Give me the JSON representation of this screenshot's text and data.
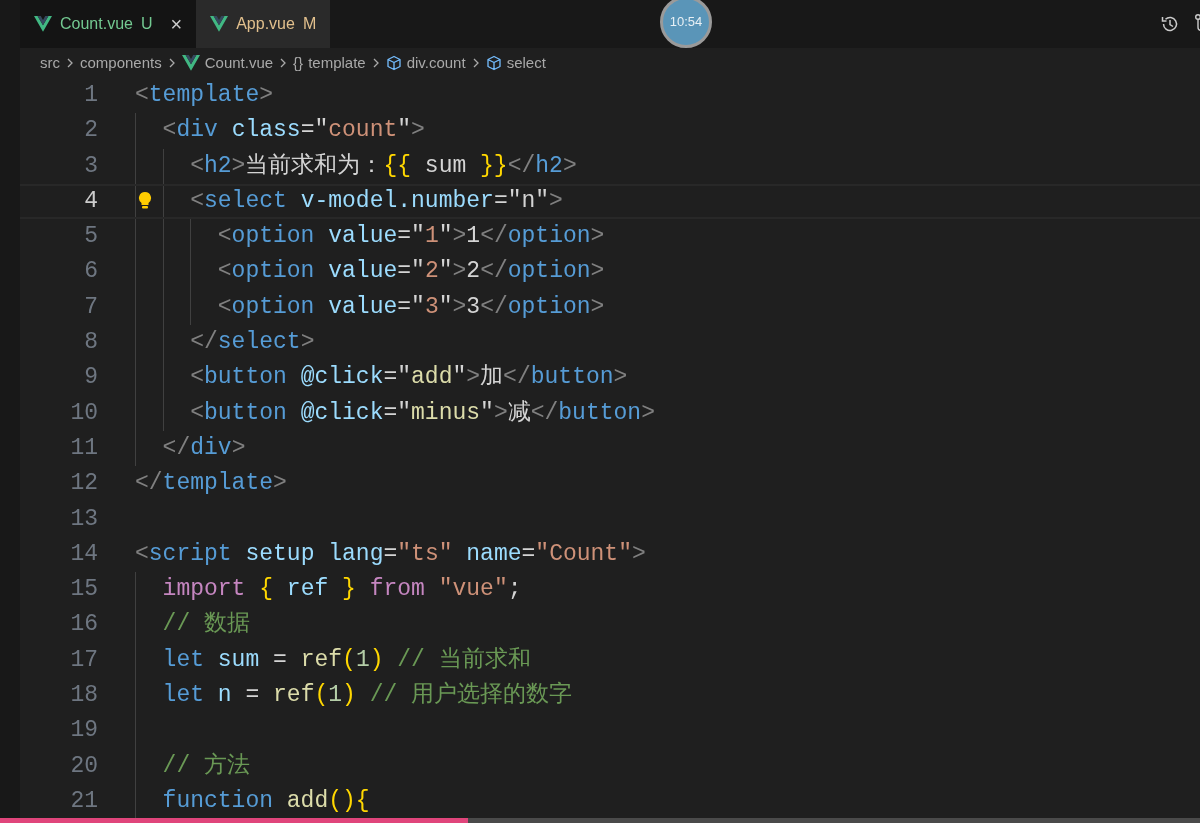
{
  "tabs": [
    {
      "label": "Count.vue",
      "git_status": "U",
      "color": "#73c991",
      "selected": true,
      "closable": true
    },
    {
      "label": "App.vue",
      "git_status": "M",
      "color": "#e2c08d",
      "selected": false,
      "closable": false
    }
  ],
  "close_glyph": "×",
  "timer_badge": "10:54",
  "breadcrumbs": [
    {
      "label": "src",
      "kind": "folder"
    },
    {
      "label": "components",
      "kind": "folder"
    },
    {
      "label": "Count.vue",
      "kind": "file"
    },
    {
      "label": "template",
      "kind": "block",
      "symbol": "{}"
    },
    {
      "label": "div.count",
      "kind": "element"
    },
    {
      "label": "select",
      "kind": "element"
    }
  ],
  "lines": [
    {
      "number": "1",
      "current": false,
      "tokens": [
        {
          "kind": "punct",
          "text": "<"
        },
        {
          "kind": "tag",
          "text": "template"
        },
        {
          "kind": "punct",
          "text": ">"
        }
      ]
    },
    {
      "number": "2",
      "current": false,
      "tokens": [
        {
          "kind": "punct",
          "text": "  <"
        },
        {
          "kind": "tag",
          "text": "div"
        },
        {
          "kind": "attr",
          "text": " class"
        },
        {
          "kind": "text",
          "text": "=\""
        },
        {
          "kind": "str",
          "text": "count"
        },
        {
          "kind": "text",
          "text": "\""
        },
        {
          "kind": "punct",
          "text": ">"
        }
      ]
    },
    {
      "number": "3",
      "current": false,
      "tokens": [
        {
          "kind": "punct",
          "text": "    <"
        },
        {
          "kind": "tag",
          "text": "h2"
        },
        {
          "kind": "punct",
          "text": ">"
        },
        {
          "kind": "text",
          "text": "当前求和为："
        },
        {
          "kind": "brace",
          "text": "{{"
        },
        {
          "kind": "text",
          "text": " sum "
        },
        {
          "kind": "brace",
          "text": "}}"
        },
        {
          "kind": "punct",
          "text": "</"
        },
        {
          "kind": "tag",
          "text": "h2"
        },
        {
          "kind": "punct",
          "text": ">"
        }
      ]
    },
    {
      "number": "4",
      "current": true,
      "lightbulb": true,
      "tokens": [
        {
          "kind": "punct",
          "text": "    <"
        },
        {
          "kind": "tag",
          "text": "select"
        },
        {
          "kind": "attr",
          "text": " v-model.number"
        },
        {
          "kind": "text",
          "text": "=\"n\""
        },
        {
          "kind": "punct",
          "text": ">"
        }
      ]
    },
    {
      "number": "5",
      "current": false,
      "tokens": [
        {
          "kind": "punct",
          "text": "      <"
        },
        {
          "kind": "tag",
          "text": "option"
        },
        {
          "kind": "attr",
          "text": " value"
        },
        {
          "kind": "text",
          "text": "=\""
        },
        {
          "kind": "str",
          "text": "1"
        },
        {
          "kind": "text",
          "text": "\""
        },
        {
          "kind": "punct",
          "text": ">"
        },
        {
          "kind": "text",
          "text": "1"
        },
        {
          "kind": "punct",
          "text": "</"
        },
        {
          "kind": "tag",
          "text": "option"
        },
        {
          "kind": "punct",
          "text": ">"
        }
      ]
    },
    {
      "number": "6",
      "current": false,
      "tokens": [
        {
          "kind": "punct",
          "text": "      <"
        },
        {
          "kind": "tag",
          "text": "option"
        },
        {
          "kind": "attr",
          "text": " value"
        },
        {
          "kind": "text",
          "text": "=\""
        },
        {
          "kind": "str",
          "text": "2"
        },
        {
          "kind": "text",
          "text": "\""
        },
        {
          "kind": "punct",
          "text": ">"
        },
        {
          "kind": "text",
          "text": "2"
        },
        {
          "kind": "punct",
          "text": "</"
        },
        {
          "kind": "tag",
          "text": "option"
        },
        {
          "kind": "punct",
          "text": ">"
        }
      ]
    },
    {
      "number": "7",
      "current": false,
      "tokens": [
        {
          "kind": "punct",
          "text": "      <"
        },
        {
          "kind": "tag",
          "text": "option"
        },
        {
          "kind": "attr",
          "text": " value"
        },
        {
          "kind": "text",
          "text": "=\""
        },
        {
          "kind": "str",
          "text": "3"
        },
        {
          "kind": "text",
          "text": "\""
        },
        {
          "kind": "punct",
          "text": ">"
        },
        {
          "kind": "text",
          "text": "3"
        },
        {
          "kind": "punct",
          "text": "</"
        },
        {
          "kind": "tag",
          "text": "option"
        },
        {
          "kind": "punct",
          "text": ">"
        }
      ]
    },
    {
      "number": "8",
      "current": false,
      "tokens": [
        {
          "kind": "punct",
          "text": "    </"
        },
        {
          "kind": "tag",
          "text": "select"
        },
        {
          "kind": "punct",
          "text": ">"
        }
      ]
    },
    {
      "number": "9",
      "current": false,
      "tokens": [
        {
          "kind": "punct",
          "text": "    <"
        },
        {
          "kind": "tag",
          "text": "button"
        },
        {
          "kind": "attr",
          "text": " @click"
        },
        {
          "kind": "text",
          "text": "=\""
        },
        {
          "kind": "func",
          "text": "add"
        },
        {
          "kind": "text",
          "text": "\""
        },
        {
          "kind": "punct",
          "text": ">"
        },
        {
          "kind": "text",
          "text": "加"
        },
        {
          "kind": "punct",
          "text": "</"
        },
        {
          "kind": "tag",
          "text": "button"
        },
        {
          "kind": "punct",
          "text": ">"
        }
      ]
    },
    {
      "number": "10",
      "current": false,
      "tokens": [
        {
          "kind": "punct",
          "text": "    <"
        },
        {
          "kind": "tag",
          "text": "button"
        },
        {
          "kind": "attr",
          "text": " @click"
        },
        {
          "kind": "text",
          "text": "=\""
        },
        {
          "kind": "func",
          "text": "minus"
        },
        {
          "kind": "text",
          "text": "\""
        },
        {
          "kind": "punct",
          "text": ">"
        },
        {
          "kind": "text",
          "text": "减"
        },
        {
          "kind": "punct",
          "text": "</"
        },
        {
          "kind": "tag",
          "text": "button"
        },
        {
          "kind": "punct",
          "text": ">"
        }
      ]
    },
    {
      "number": "11",
      "current": false,
      "tokens": [
        {
          "kind": "punct",
          "text": "  </"
        },
        {
          "kind": "tag",
          "text": "div"
        },
        {
          "kind": "punct",
          "text": ">"
        }
      ]
    },
    {
      "number": "12",
      "current": false,
      "tokens": [
        {
          "kind": "punct",
          "text": "</"
        },
        {
          "kind": "tag",
          "text": "template"
        },
        {
          "kind": "punct",
          "text": ">"
        }
      ]
    },
    {
      "number": "13",
      "current": false
    },
    {
      "number": "14",
      "current": false,
      "tokens": [
        {
          "kind": "punct",
          "text": "<"
        },
        {
          "kind": "tag",
          "text": "script"
        },
        {
          "kind": "attr",
          "text": " setup lang"
        },
        {
          "kind": "text",
          "text": "="
        },
        {
          "kind": "str",
          "text": "\"ts\""
        },
        {
          "kind": "attr",
          "text": " name"
        },
        {
          "kind": "text",
          "text": "="
        },
        {
          "kind": "str",
          "text": "\"Count\""
        },
        {
          "kind": "punct",
          "text": ">"
        }
      ]
    },
    {
      "number": "15",
      "current": false,
      "tokens": [
        {
          "kind": "kw",
          "text": "  import"
        },
        {
          "kind": "brace",
          "text": " {"
        },
        {
          "kind": "var",
          "text": " ref "
        },
        {
          "kind": "brace",
          "text": "}"
        },
        {
          "kind": "kw",
          "text": " from"
        },
        {
          "kind": "str",
          "text": " \"vue\""
        },
        {
          "kind": "text",
          "text": ";"
        }
      ]
    },
    {
      "number": "16",
      "current": false,
      "tokens": [
        {
          "kind": "comment",
          "text": "  // 数据"
        }
      ]
    },
    {
      "number": "17",
      "current": false,
      "tokens": [
        {
          "kind": "tag",
          "text": "  let"
        },
        {
          "kind": "var",
          "text": " sum"
        },
        {
          "kind": "text",
          "text": " = "
        },
        {
          "kind": "func",
          "text": "ref"
        },
        {
          "kind": "brace",
          "text": "("
        },
        {
          "kind": "num",
          "text": "1"
        },
        {
          "kind": "brace",
          "text": ")"
        },
        {
          "kind": "comment",
          "text": " // 当前求和"
        }
      ]
    },
    {
      "number": "18",
      "current": false,
      "tokens": [
        {
          "kind": "tag",
          "text": "  let"
        },
        {
          "kind": "var",
          "text": " n"
        },
        {
          "kind": "text",
          "text": " = "
        },
        {
          "kind": "func",
          "text": "ref"
        },
        {
          "kind": "brace",
          "text": "("
        },
        {
          "kind": "num",
          "text": "1"
        },
        {
          "kind": "brace",
          "text": ")"
        },
        {
          "kind": "comment",
          "text": " // 用户选择的数字"
        }
      ]
    },
    {
      "number": "19",
      "current": false
    },
    {
      "number": "20",
      "current": false,
      "tokens": [
        {
          "kind": "comment",
          "text": "  // 方法"
        }
      ]
    },
    {
      "number": "21",
      "current": false,
      "tokens": [
        {
          "kind": "tag",
          "text": "  function"
        },
        {
          "kind": "func",
          "text": " add"
        },
        {
          "kind": "brace",
          "text": "(){"
        }
      ]
    }
  ],
  "video_progress": {
    "level": 0.39
  }
}
